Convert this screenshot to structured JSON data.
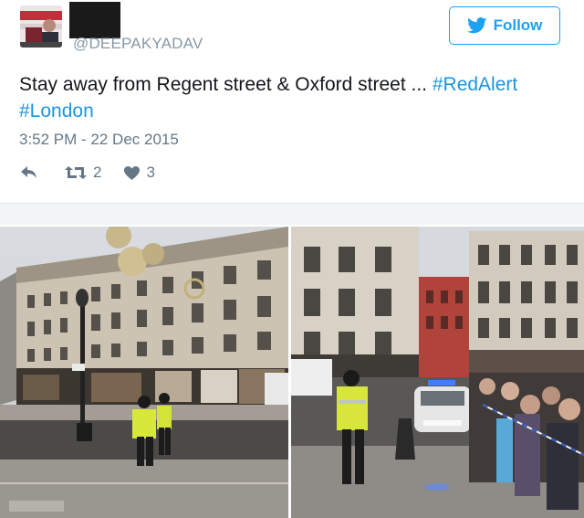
{
  "tweet": {
    "handle": "@DEEPAKYADAV",
    "follow_label": "Follow",
    "text_main": "Stay away from Regent street & Oxford street ... ",
    "hashtag_1": "#RedAlert",
    "hashtag_2": "#London",
    "timestamp": "3:52 PM - 22 Dec 2015",
    "retweets": "2",
    "likes": "3"
  },
  "colors": {
    "accent": "#1da1f2",
    "hashtag": "#1b95e0",
    "muted": "#657786",
    "handle": "#8899a6"
  },
  "icons": {
    "follow": "twitter-bird-icon",
    "reply": "reply-arrow-icon",
    "retweet": "retweet-icon",
    "like": "heart-icon"
  },
  "media": {
    "photo_count": 2
  }
}
